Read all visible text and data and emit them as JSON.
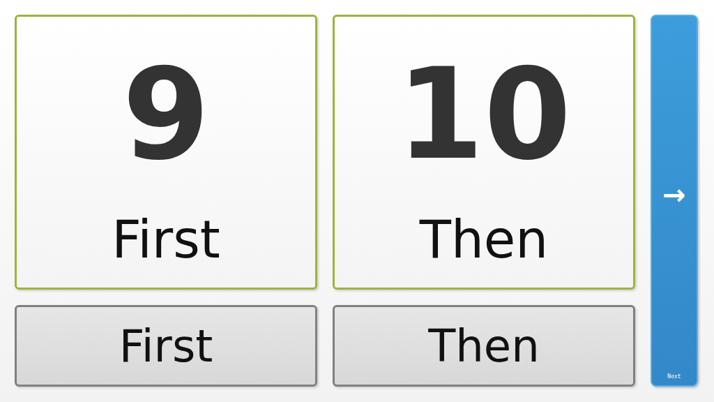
{
  "cards": [
    {
      "number": "9",
      "caption": "First",
      "button": "First"
    },
    {
      "number": "10",
      "caption": "Then",
      "button": "Then"
    }
  ],
  "next_button": {
    "arrow": "→",
    "label": "Next"
  }
}
